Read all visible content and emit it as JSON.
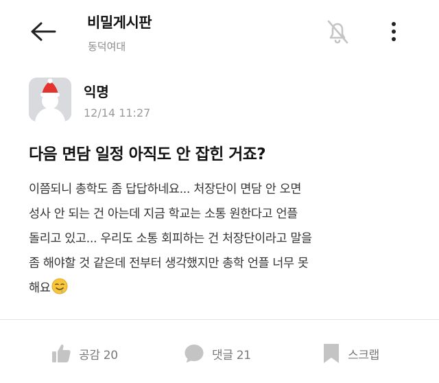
{
  "header": {
    "title": "비밀게시판",
    "subtitle": "동덕여대",
    "icons": {
      "back": "back-arrow-icon",
      "notification": "bell-off-icon",
      "more": "more-vertical-icon"
    }
  },
  "post": {
    "author": "익명",
    "timestamp": "12/14 11:27",
    "title": "다음 면담 일정 아직도 안 잡힌 거죠?",
    "body_lines": [
      "이쯤되니 총학도 좀 답답하네요... 처장단이 면담 안 오면",
      "성사 안 되는 건 아는데 지금 학교는 소통 원한다고 언플",
      "돌리고 있고... 우리도 소통 회피하는 건 처장단이라고 말을",
      "좀 해야할 것 같은데 전부터 생각했지만 총학 언플 너무 못",
      "해요"
    ],
    "emoji": "drooling-face-emoji"
  },
  "actions": {
    "like": {
      "label": "공감 20",
      "icon": "thumbs-up-icon"
    },
    "comment": {
      "label": "댓글 21",
      "icon": "comment-bubble-icon"
    },
    "scrap": {
      "label": "스크랩",
      "icon": "bookmark-icon"
    }
  },
  "colors": {
    "icon_gray": "#c4c4c4",
    "text_gray": "#777777",
    "avatar_bg": "#d9dadd",
    "santa_red": "#e4332e"
  }
}
